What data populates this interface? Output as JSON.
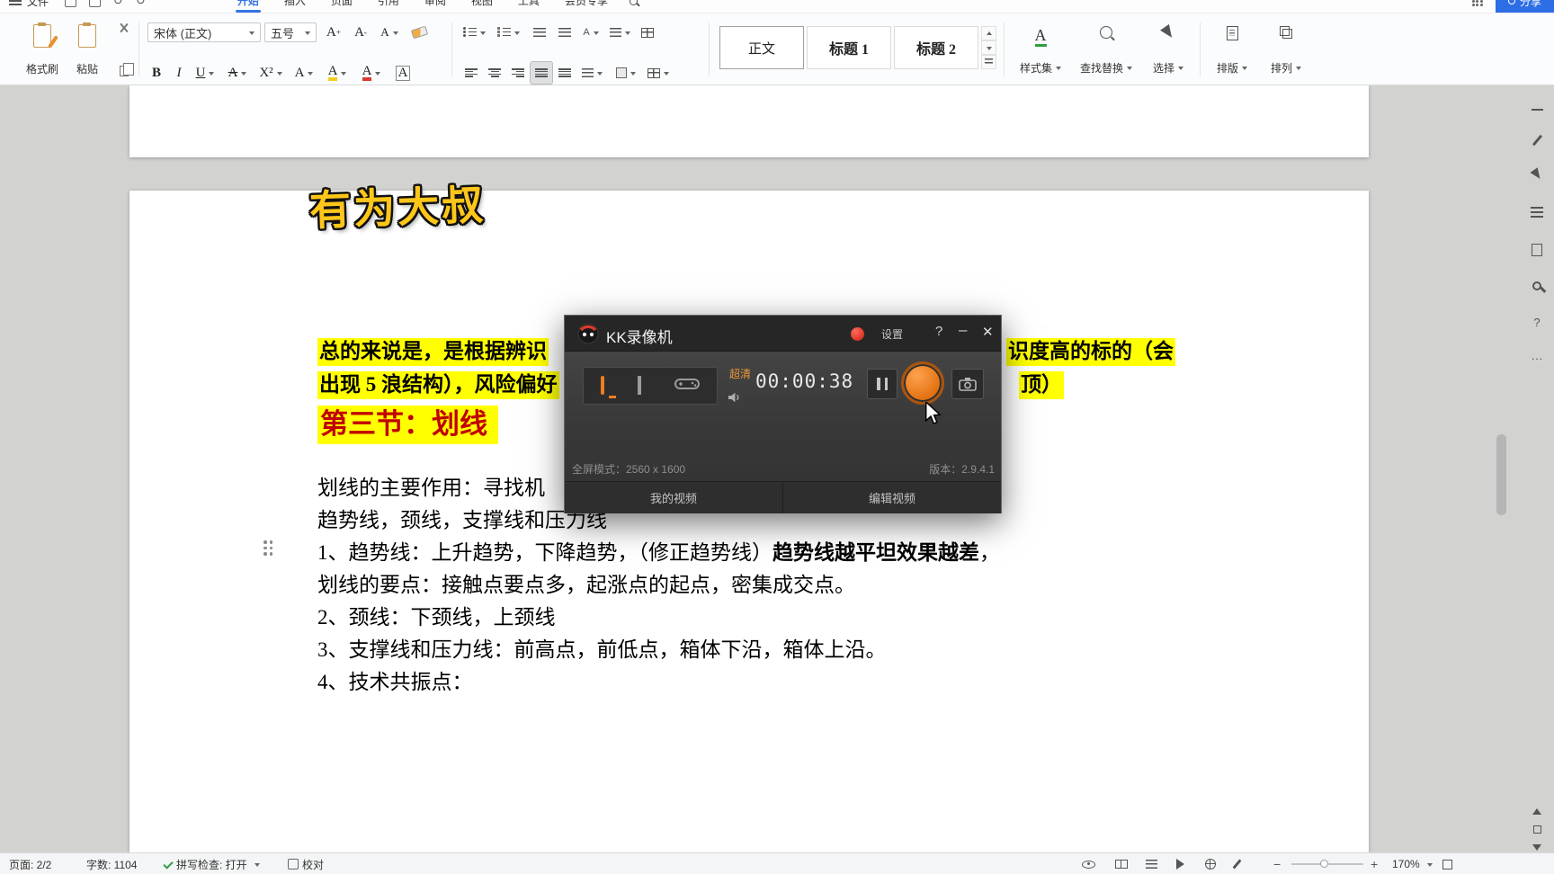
{
  "menubar": {
    "file": "文件",
    "tabs": [
      "开始",
      "插入",
      "页面",
      "引用",
      "审阅",
      "视图",
      "工具",
      "会员专享"
    ],
    "active_tab": "开始",
    "share": "分享"
  },
  "icons": {
    "undo": "↺",
    "redo": "↻"
  },
  "ribbon": {
    "format_painter": "格式刷",
    "paste": "粘贴",
    "font_name": "宋体 (正文)",
    "font_size": "五号",
    "bold": "B",
    "italic": "I",
    "underline": "U",
    "strikethrough": "A",
    "superscript": "X²",
    "text_effects": "A",
    "highlight": "A",
    "font_color": "A",
    "char_border": "A",
    "styles": [
      "正文",
      "标题 1",
      "标题 2"
    ],
    "style_set": "样式集",
    "find_replace": "查找替换",
    "select": "选择",
    "typeset": "排版",
    "arrange": "排列"
  },
  "document": {
    "brand": "有为大叔",
    "hl1_left": "总的来说是，是根据辨识",
    "hl1_right": "识度高的标的（会",
    "hl2_left": "出现 5 浪结构），风险偏好",
    "hl2_right": "顶）",
    "heading": "第三节：划线",
    "body1": "划线的主要作用：寻找机",
    "body2": "趋势线，颈线，支撑线和压力线",
    "body3_a": "1、趋势线：上升趋势，下降趋势，（修正趋势线）",
    "body3_b": "趋势线越平坦效果越差",
    "body3_c": "，",
    "body4": "划线的要点：接触点要点多，起涨点的起点，密集成交点。",
    "body5": "2、颈线：下颈线，上颈线",
    "body6": "3、支撑线和压力线：前高点，前低点，箱体下沿，箱体上沿。",
    "body7": "4、技术共振点："
  },
  "recorder": {
    "title": "KK录像机",
    "settings": "设置",
    "help": "?",
    "minimize": "–",
    "close": "✕",
    "quality": "超清",
    "timer": "00:00:38",
    "mode_info": "全屏模式：2560 x 1600",
    "version": "版本：2.9.4.1",
    "my_videos": "我的视频",
    "edit_videos": "编辑视频"
  },
  "sidebar": {
    "help": "?",
    "more": "···"
  },
  "statusbar": {
    "page": "页面: 2/2",
    "words": "字数: 1104",
    "spell": "拼写检查: 打开",
    "proof": "校对",
    "zoom": "170%"
  },
  "colors": {
    "accent_blue": "#3673e8",
    "highlight_yellow": "#ffff00",
    "heading_red": "#c00000",
    "recorder_orange": "#e87722"
  }
}
